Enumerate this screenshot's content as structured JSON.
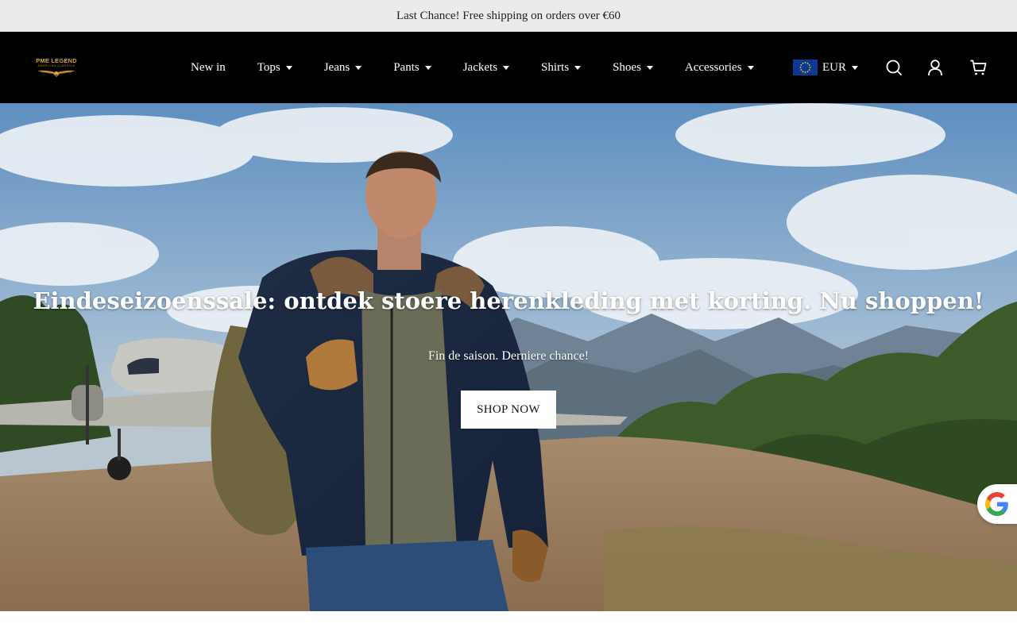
{
  "announcement": {
    "text": "Last Chance! Free shipping on orders over €60"
  },
  "brand": {
    "name": "PME LEGEND",
    "tagline": "AMERICAN CLASSICS",
    "color": "#d7a23a"
  },
  "nav": {
    "items": [
      {
        "label": "New in",
        "has_dropdown": false
      },
      {
        "label": "Tops",
        "has_dropdown": true
      },
      {
        "label": "Jeans",
        "has_dropdown": true
      },
      {
        "label": "Pants",
        "has_dropdown": true
      },
      {
        "label": "Jackets",
        "has_dropdown": true
      },
      {
        "label": "Shirts",
        "has_dropdown": true
      },
      {
        "label": "Shoes",
        "has_dropdown": true
      },
      {
        "label": "Accessories",
        "has_dropdown": true
      }
    ]
  },
  "currency": {
    "selected": "EUR",
    "flag": "eu-flag-icon"
  },
  "header_icons": [
    "search-icon",
    "account-icon",
    "cart-icon"
  ],
  "hero": {
    "title": "Eindeseizoenssale: ontdek stoere herenkleding met korting. Nu shoppen!",
    "subtitle": "Fin de saison. Derniere chance!",
    "cta_label": "SHOP NOW"
  },
  "floating": {
    "google_badge": "google-icon"
  },
  "colors": {
    "header_bg": "#000000",
    "announcement_bg": "#ebebeb",
    "cta_bg": "#ffffff"
  }
}
